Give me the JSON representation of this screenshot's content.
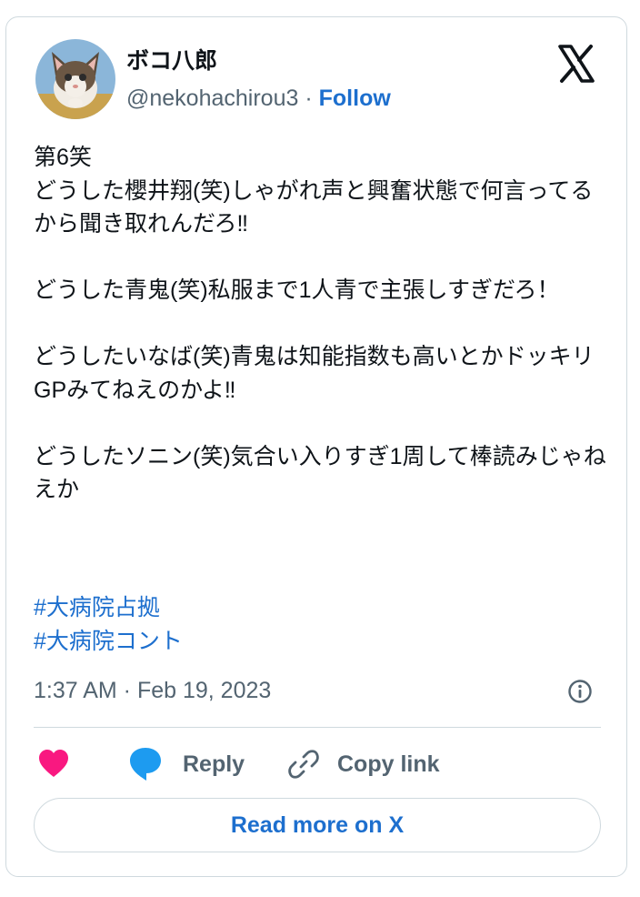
{
  "author": {
    "display_name": "ボコ八郎",
    "handle": "@nekohachirou3",
    "separator": "·",
    "follow_label": "Follow",
    "avatar_icon": "cat-avatar"
  },
  "platform_icon": "x-logo-icon",
  "tweet": {
    "text": "第6笑\nどうした櫻井翔(笑)しゃがれ声と興奮状態で何言ってるから聞き取れんだろ‼︎\n\nどうした青鬼(笑)私服まで1人青で主張しすぎだろ！\n\nどうしたいなば(笑)青鬼は知能指数も高いとかドッキリGPみてねえのかよ‼︎\n\nどうしたソニン(笑)気合い入りすぎ1周して棒読みじゃねえか",
    "hashtags": [
      "#大病院占拠",
      "#大病院コント"
    ],
    "timestamp": "1:37 AM · Feb 19, 2023"
  },
  "actions": {
    "like_icon": "heart-icon",
    "reply_label": "Reply",
    "copy_link_label": "Copy link"
  },
  "read_more_label": "Read more on X",
  "colors": {
    "accent": "#1d6fce",
    "heart": "#f91880",
    "reply_bubble": "#1d9bf0",
    "muted": "#536471",
    "border": "#cfd9de"
  }
}
